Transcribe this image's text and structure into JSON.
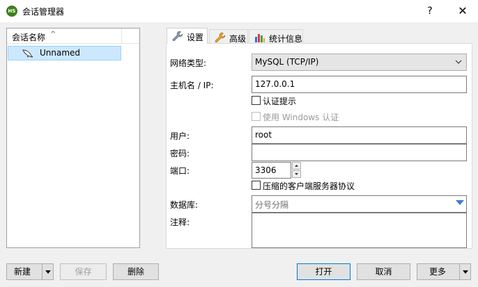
{
  "window": {
    "title": "会话管理器",
    "app_icon_text": "HS",
    "help_glyph": "?",
    "close_glyph": "✕"
  },
  "sessions": {
    "column_header": "会话名称",
    "sort_glyph": "^",
    "items": [
      {
        "label": "Unnamed"
      }
    ]
  },
  "tabs": [
    {
      "label": "设置",
      "active": true
    },
    {
      "label": "高级",
      "active": false
    },
    {
      "label": "统计信息",
      "active": false
    }
  ],
  "form": {
    "network_type_label": "网络类型:",
    "network_type_value": "MySQL (TCP/IP)",
    "host_label": "主机名 / IP:",
    "host_value": "127.0.0.1",
    "auth_prompt_label": "认证提示",
    "auth_prompt_checked": false,
    "windows_auth_label": "使用 Windows 认证",
    "windows_auth_checked": false,
    "user_label": "用户:",
    "user_value": "root",
    "password_label": "密码:",
    "password_value": "",
    "port_label": "端口:",
    "port_value": "3306",
    "compress_label": "压缩的客户端服务器协议",
    "compress_checked": false,
    "database_label": "数据库:",
    "database_placeholder": "分号分隔",
    "comment_label": "注释:",
    "comment_value": ""
  },
  "buttons": {
    "new": "新建",
    "save": "保存",
    "delete": "删除",
    "open": "打开",
    "cancel": "取消",
    "more": "更多"
  },
  "colors": {
    "selection_bg": "#cce8ff",
    "selection_border": "#99d1ff",
    "primary_border": "#0078d7",
    "dropdown_arrow": "#3b7dd8"
  }
}
